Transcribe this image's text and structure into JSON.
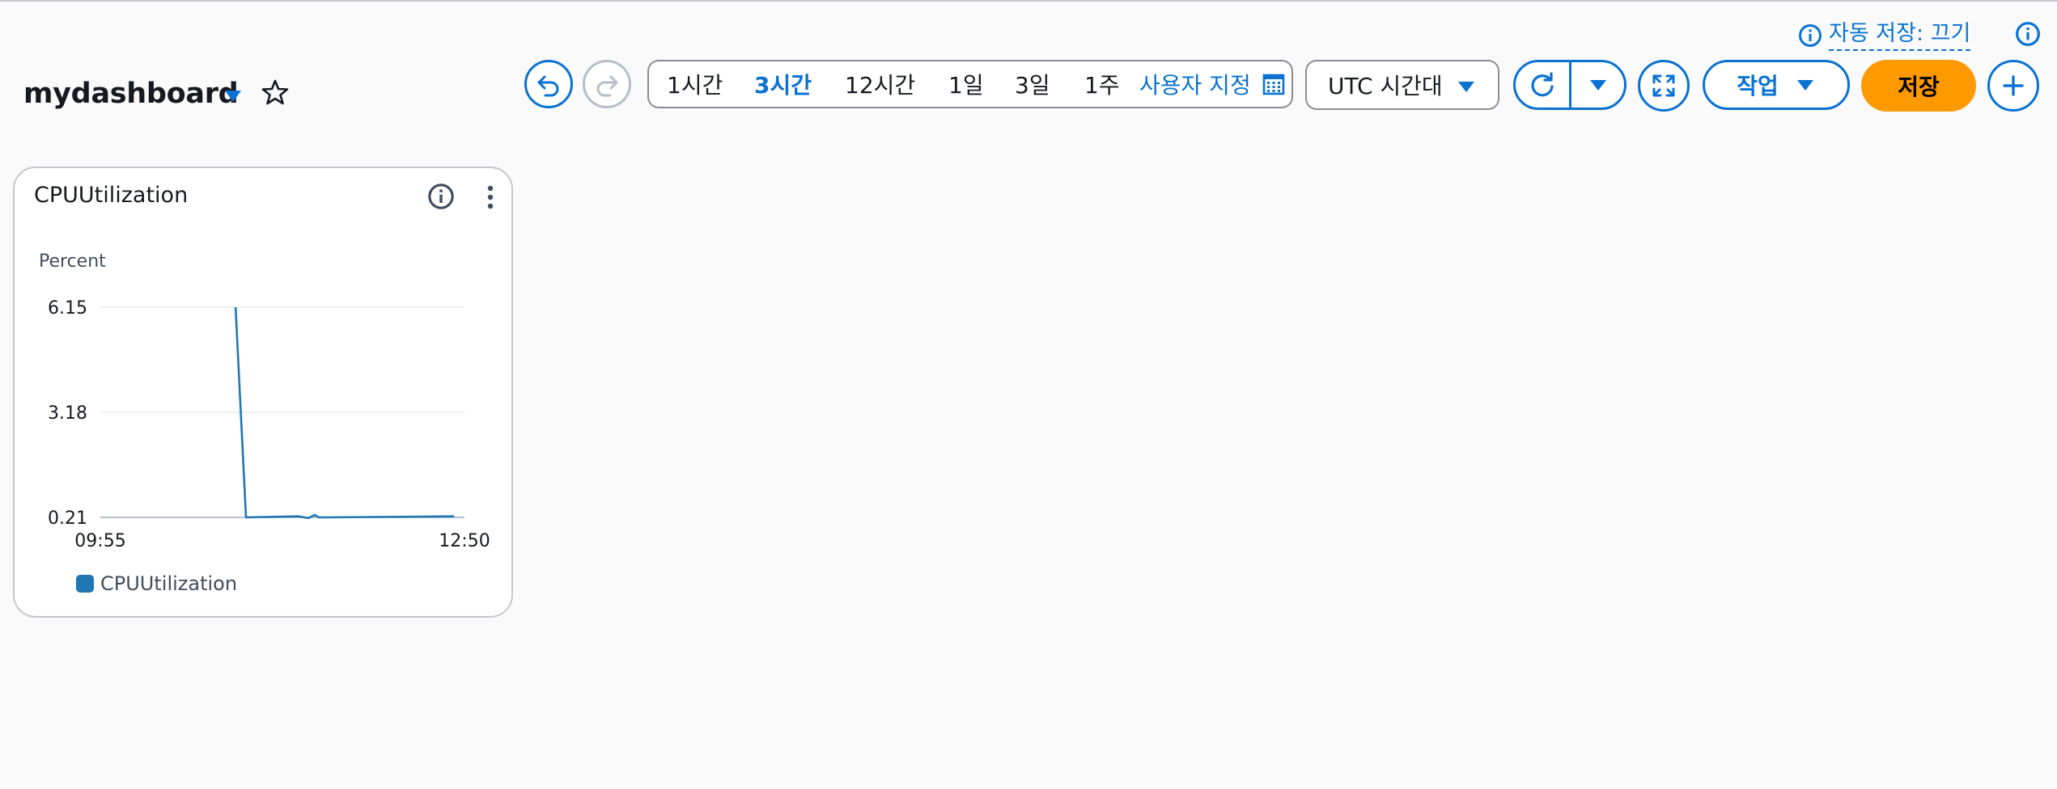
{
  "header": {
    "autosave_label": "자동 저장: 끄기",
    "dashboard_title": "mydashboard"
  },
  "time_range": {
    "options": [
      "1시간",
      "3시간",
      "12시간",
      "1일",
      "3일",
      "1주"
    ],
    "active": "3시간",
    "custom_label": "사용자 지정"
  },
  "timezone": {
    "selected": "UTC 시간대"
  },
  "actions_label": "작업",
  "save_label": "저장",
  "widget": {
    "title": "CPUUtilization",
    "legend": "CPUUtilization"
  },
  "chart_data": {
    "type": "line",
    "title": "CPUUtilization",
    "ylabel": "Percent",
    "ylim": [
      0.21,
      6.15
    ],
    "yticks": [
      "6.15",
      "3.18",
      "0.21"
    ],
    "xticks": [
      "09:55",
      "12:50"
    ],
    "series": [
      {
        "name": "CPUUtilization",
        "color": "#1f77b4",
        "x": [
          "11:00",
          "11:05",
          "11:30",
          "11:35",
          "11:38",
          "11:40",
          "11:43",
          "12:45"
        ],
        "values": [
          6.15,
          0.21,
          0.24,
          0.19,
          0.28,
          0.21,
          0.21,
          0.24
        ]
      }
    ],
    "grid": true,
    "legend": "bottom-left"
  },
  "colors": {
    "accent": "#0972d3",
    "primary_button": "#ff9900",
    "series": "#1f77b4"
  }
}
